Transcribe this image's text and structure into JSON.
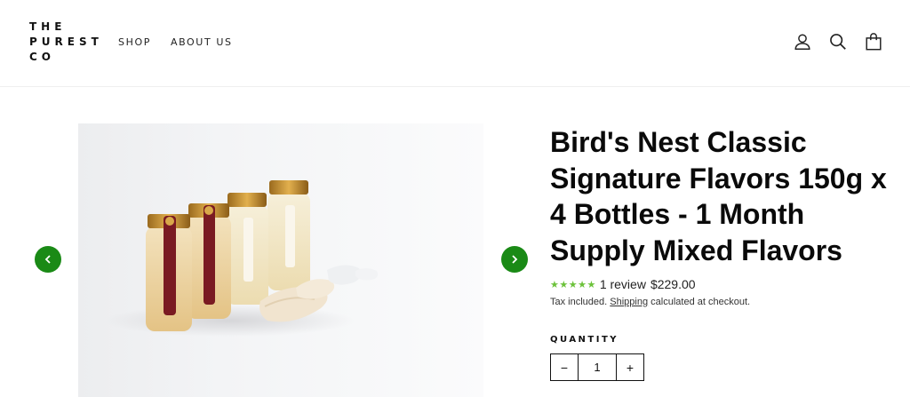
{
  "brand": {
    "line1": "THE",
    "line2": "PUREST",
    "line3": "CO"
  },
  "nav": {
    "shop": "SHOP",
    "about": "ABOUT US"
  },
  "header_icons": [
    "user-icon",
    "search-icon",
    "cart-icon"
  ],
  "colors": {
    "accent": "#1a8a16",
    "stars": "#6cc23a",
    "jar_label_red": "#7a1a22",
    "jar_label_cream": "#f3ece0"
  },
  "product": {
    "title": "Bird's Nest Classic Signature Flavors 150g x 4 Bottles - 1 Month Supply Mixed Flavors",
    "stars": "★★★★★",
    "review_count": "1 review",
    "price": "$229.00",
    "tax_prefix": "Tax included.",
    "shipping_link": "Shipping",
    "tax_suffix": "calculated at checkout."
  },
  "quantity": {
    "label": "QUANTITY",
    "value": "1",
    "minus": "−",
    "plus": "+"
  }
}
